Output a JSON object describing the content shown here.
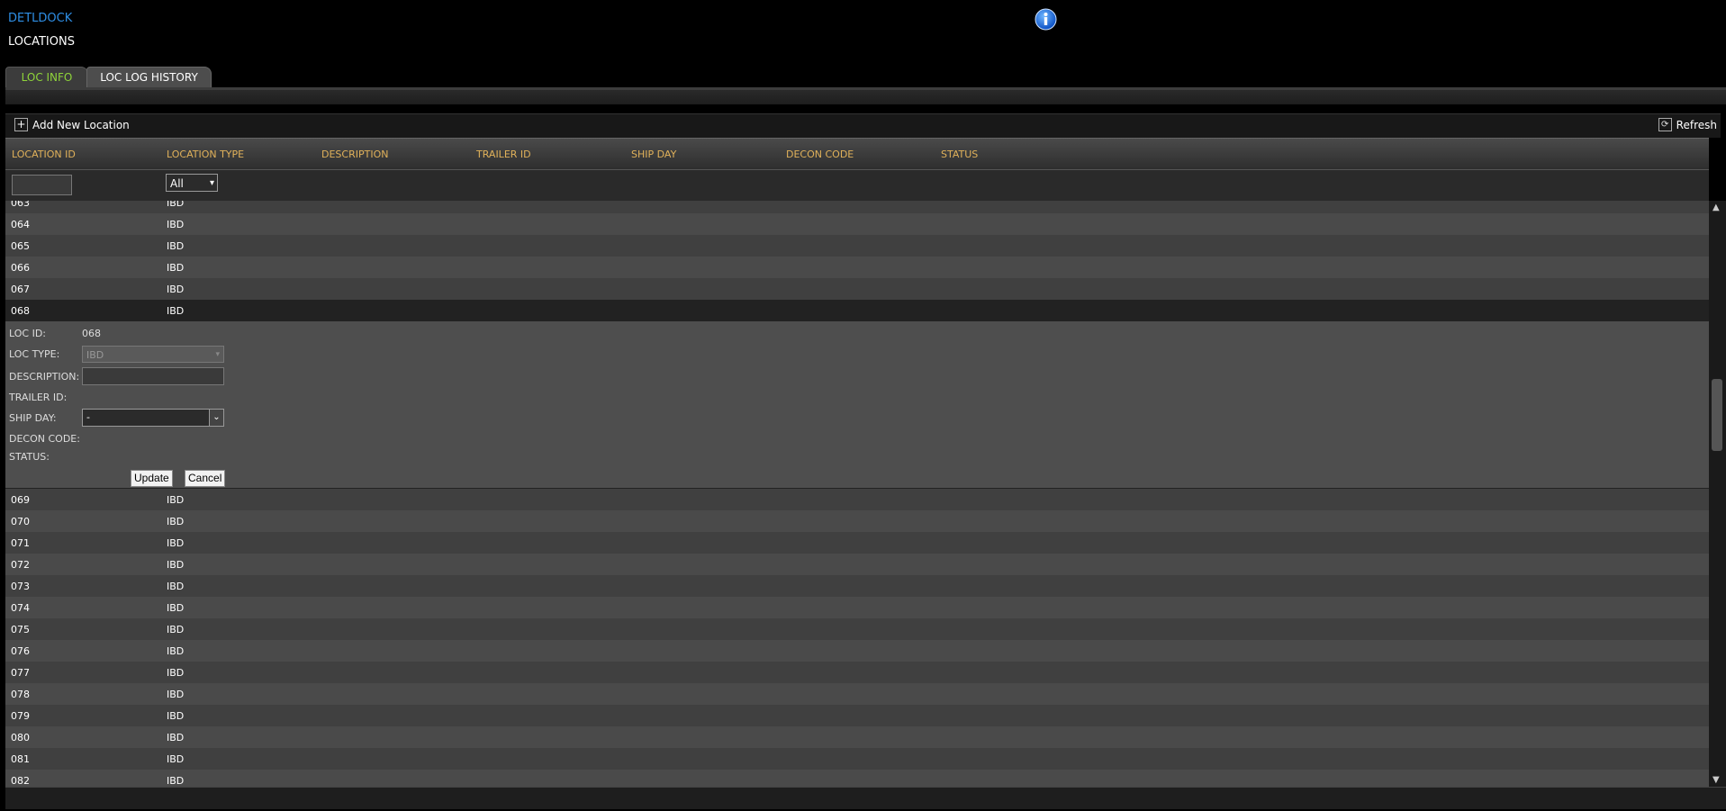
{
  "header": {
    "app_link": "DETLDOCK",
    "page_title": "LOCATIONS"
  },
  "tabs": [
    {
      "label": "LOC INFO",
      "active": true
    },
    {
      "label": "LOC LOG HISTORY",
      "active": false
    }
  ],
  "toolbar": {
    "add_label": "Add New Location",
    "refresh_label": "Refresh"
  },
  "columns": [
    "LOCATION ID",
    "LOCATION TYPE",
    "DESCRIPTION",
    "TRAILER ID",
    "SHIP DAY",
    "DECON CODE",
    "STATUS"
  ],
  "filter": {
    "location_id_value": "",
    "location_type_selected": "All"
  },
  "rows_before": [
    {
      "id": "063",
      "type": "IBD"
    },
    {
      "id": "064",
      "type": "IBD"
    },
    {
      "id": "065",
      "type": "IBD"
    },
    {
      "id": "066",
      "type": "IBD"
    },
    {
      "id": "067",
      "type": "IBD"
    },
    {
      "id": "068",
      "type": "IBD"
    }
  ],
  "edit_form": {
    "loc_id_label": "LOC ID:",
    "loc_id_value": "068",
    "loc_type_label": "LOC TYPE:",
    "loc_type_value": "IBD",
    "description_label": "DESCRIPTION:",
    "description_value": "",
    "trailer_id_label": "TRAILER ID:",
    "ship_day_label": "SHIP DAY:",
    "ship_day_value": "-",
    "decon_code_label": "DECON CODE:",
    "status_label": "STATUS:",
    "update_label": "Update",
    "cancel_label": "Cancel"
  },
  "rows_after": [
    {
      "id": "069",
      "type": "IBD"
    },
    {
      "id": "070",
      "type": "IBD"
    },
    {
      "id": "071",
      "type": "IBD"
    },
    {
      "id": "072",
      "type": "IBD"
    },
    {
      "id": "073",
      "type": "IBD"
    },
    {
      "id": "074",
      "type": "IBD"
    },
    {
      "id": "075",
      "type": "IBD"
    },
    {
      "id": "076",
      "type": "IBD"
    },
    {
      "id": "077",
      "type": "IBD"
    },
    {
      "id": "078",
      "type": "IBD"
    },
    {
      "id": "079",
      "type": "IBD"
    },
    {
      "id": "080",
      "type": "IBD"
    },
    {
      "id": "081",
      "type": "IBD"
    },
    {
      "id": "082",
      "type": "IBD"
    }
  ],
  "icons": {
    "info": "info-icon",
    "add": "plus-icon",
    "refresh": "refresh-icon"
  },
  "colors": {
    "accent_link": "#2f8fe6",
    "active_tab": "#8fd43a",
    "header_text": "#e0b15a"
  }
}
